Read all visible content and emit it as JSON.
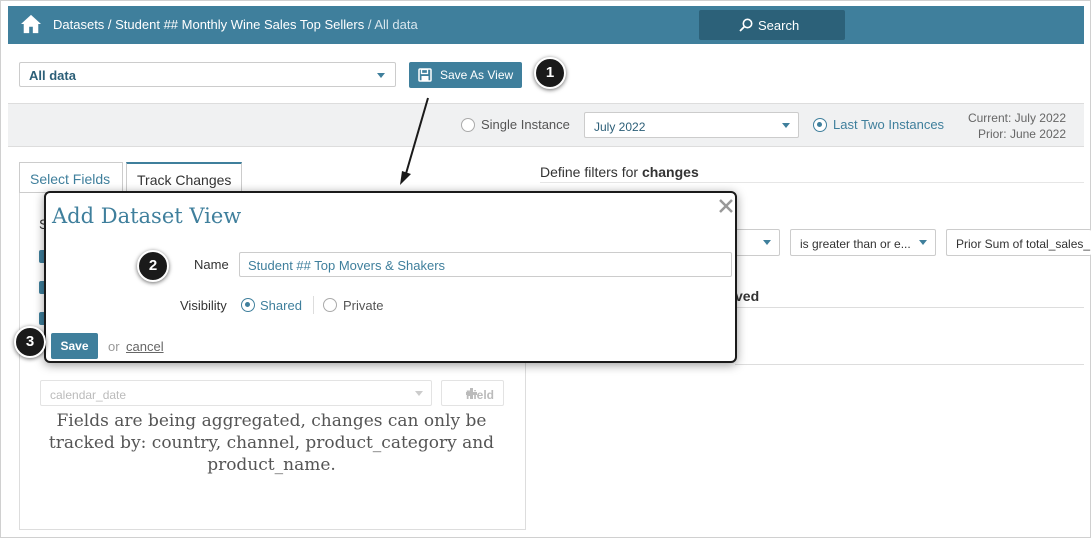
{
  "topbar": {
    "icon": "home-icon",
    "breadcrumb_path": "Datasets / Student ## Monthly Wine Sales Top Sellers",
    "breadcrumb_current": " / All data",
    "search_label": "Search"
  },
  "view": {
    "selected": "All data",
    "save_as_view_label": "Save As View"
  },
  "instances": {
    "single_label": "Single Instance",
    "month": "July 2022",
    "last_two_label": "Last Two Instances",
    "current": "Current: July 2022",
    "prior": "Prior: June 2022"
  },
  "tabs": [
    {
      "label": "Select Fields"
    },
    {
      "label": "Track Changes"
    }
  ],
  "left": {
    "peek_letter": "S",
    "date_placeholder": "calendar_date",
    "field_label": "Field",
    "aggregation_message": "Fields are being aggregated, changes can only be tracked by: country, channel, product_category and product_name."
  },
  "right": {
    "filters_prefix": "Define filters for ",
    "filters_bold": "changes",
    "operator": "is greater than or e...",
    "comparison": "Prior Sum of total_sales_",
    "column_partial": "ved"
  },
  "dialog": {
    "title": "Add Dataset View",
    "name_label": "Name",
    "name_value": "Student ## Top Movers & Shakers",
    "visibility_label": "Visibility",
    "shared_label": "Shared",
    "private_label": "Private",
    "save_label": "Save",
    "or_text": "or",
    "cancel_label": "cancel"
  },
  "callouts": [
    "1",
    "2",
    "3"
  ],
  "colors": {
    "primary": "#3f7f9c",
    "nav_dark": "#2c6179",
    "callout": "#1a1a1a"
  }
}
